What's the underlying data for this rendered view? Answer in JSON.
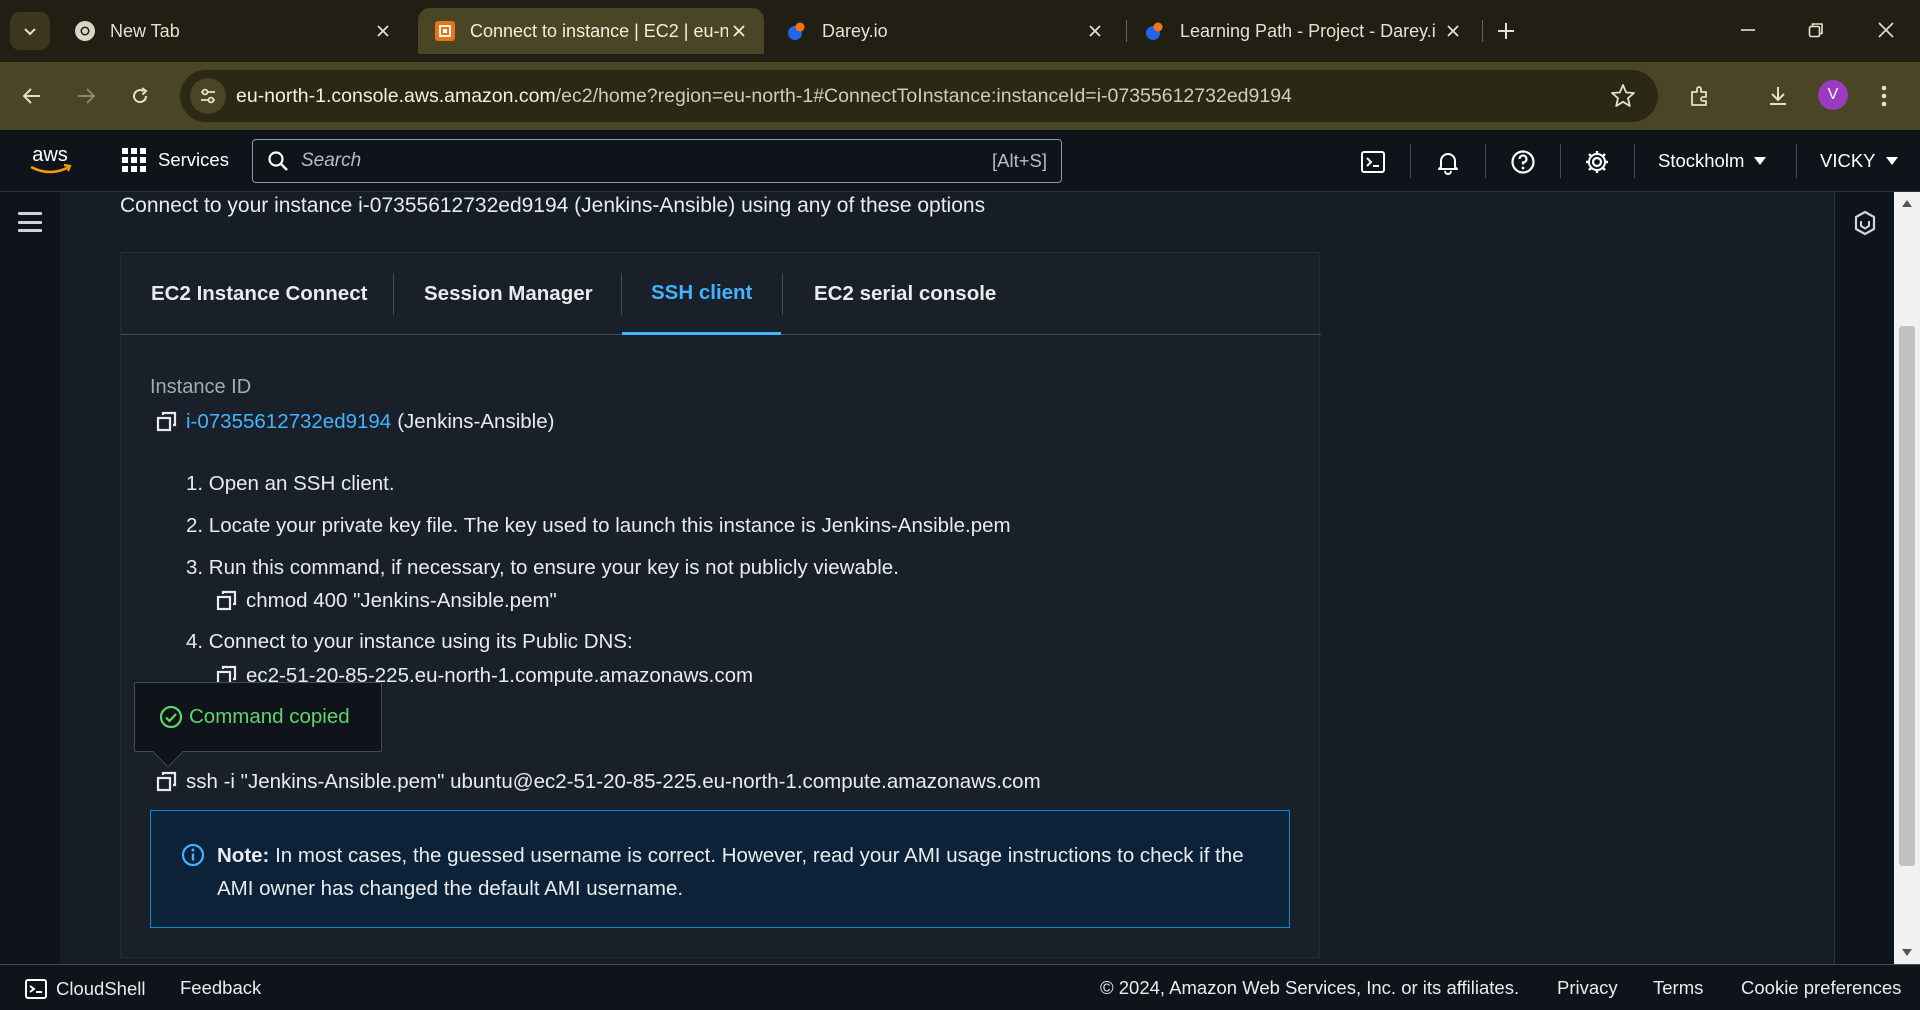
{
  "browser": {
    "tabs": [
      {
        "title": "New Tab",
        "icon": "chrome-icon",
        "active": false
      },
      {
        "title": "Connect to instance | EC2 | eu-n",
        "icon": "aws-ec2-icon",
        "active": true
      },
      {
        "title": "Darey.io",
        "icon": "darey-icon",
        "active": false
      },
      {
        "title": "Learning Path - Project - Darey.i",
        "icon": "darey-icon",
        "active": false
      }
    ],
    "url_host": "eu-north-1.console.aws.amazon.com",
    "url_path": "/ec2/home?region=eu-north-1#ConnectToInstance:instanceId=i-07355612732ed9194",
    "profile_initial": "V"
  },
  "aws_header": {
    "services_label": "Services",
    "search_placeholder": "Search",
    "search_shortcut": "[Alt+S]",
    "region": "Stockholm",
    "account": "VICKY"
  },
  "main": {
    "intro": "Connect to your instance i-07355612732ed9194 (Jenkins-Ansible) using any of these options",
    "tabs": [
      {
        "label": "EC2 Instance Connect",
        "active": false
      },
      {
        "label": "Session Manager",
        "active": false
      },
      {
        "label": "SSH client",
        "active": true
      },
      {
        "label": "EC2 serial console",
        "active": false
      }
    ],
    "instance_id_label": "Instance ID",
    "instance_id": "i-07355612732ed9194",
    "instance_name": "(Jenkins-Ansible)",
    "steps": [
      "1. Open an SSH client.",
      "2. Locate your private key file. The key used to launch this instance is Jenkins-Ansible.pem",
      "3. Run this command, if necessary, to ensure your key is not publicly viewable.",
      "4. Connect to your instance using its Public DNS:"
    ],
    "chmod_command": "chmod 400 \"Jenkins-Ansible.pem\"",
    "public_dns": "ec2-51-20-85-225.eu-north-1.compute.amazonaws.com",
    "ssh_command": "ssh -i \"Jenkins-Ansible.pem\" ubuntu@ec2-51-20-85-225.eu-north-1.compute.amazonaws.com",
    "tooltip": "Command copied",
    "note_label": "Note:",
    "note_text": " In most cases, the guessed username is correct. However, read your AMI usage instructions to check if the AMI owner has changed the default AMI username."
  },
  "footer": {
    "cloudshell": "CloudShell",
    "feedback": "Feedback",
    "copyright": "© 2024, Amazon Web Services, Inc. or its affiliates.",
    "privacy": "Privacy",
    "terms": "Terms",
    "cookie": "Cookie preferences"
  },
  "colors": {
    "accent_link": "#42b4ff",
    "success": "#5fd36b",
    "browser_frame": "#4a4524"
  }
}
